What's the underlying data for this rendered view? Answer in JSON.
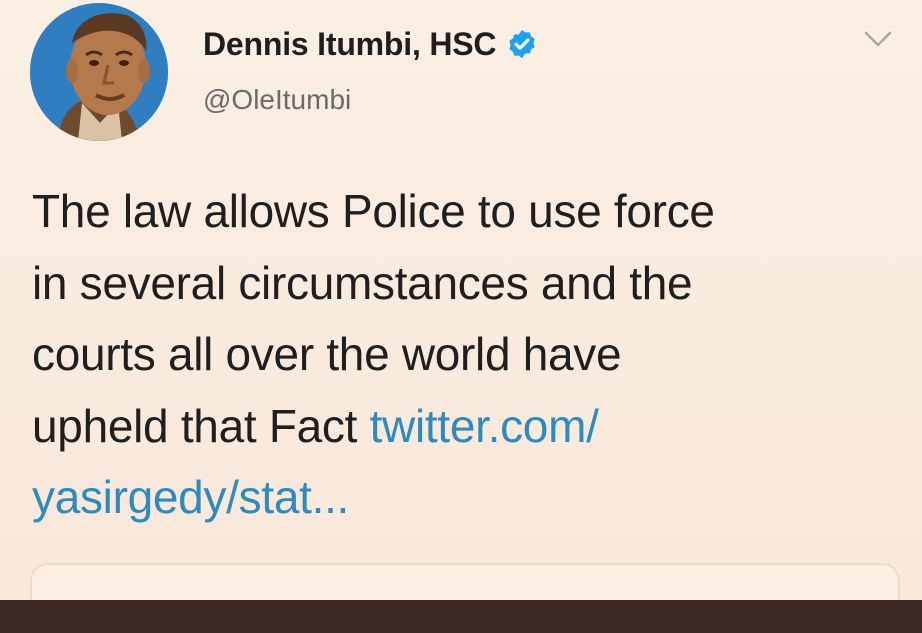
{
  "tweet": {
    "author": {
      "display_name": "Dennis Itumbi, HSC",
      "handle": "@OleItumbi",
      "verified": true
    },
    "text_lines": [
      "The law allows Police to use force",
      "in several circumstances and the",
      "courts all over the world have",
      "upheld that Fact "
    ],
    "link_part1": "twitter.com/",
    "link_part2": "yasirgedy/stat...",
    "icons": {
      "menu": "chevron-down-icon",
      "verified": "verified-badge-icon",
      "avatar": "profile-photo"
    },
    "colors": {
      "background": "#f8e9dd",
      "link": "#2d8bbf",
      "verified": "#1da1f2",
      "bottom_bar": "#3c2621"
    }
  }
}
